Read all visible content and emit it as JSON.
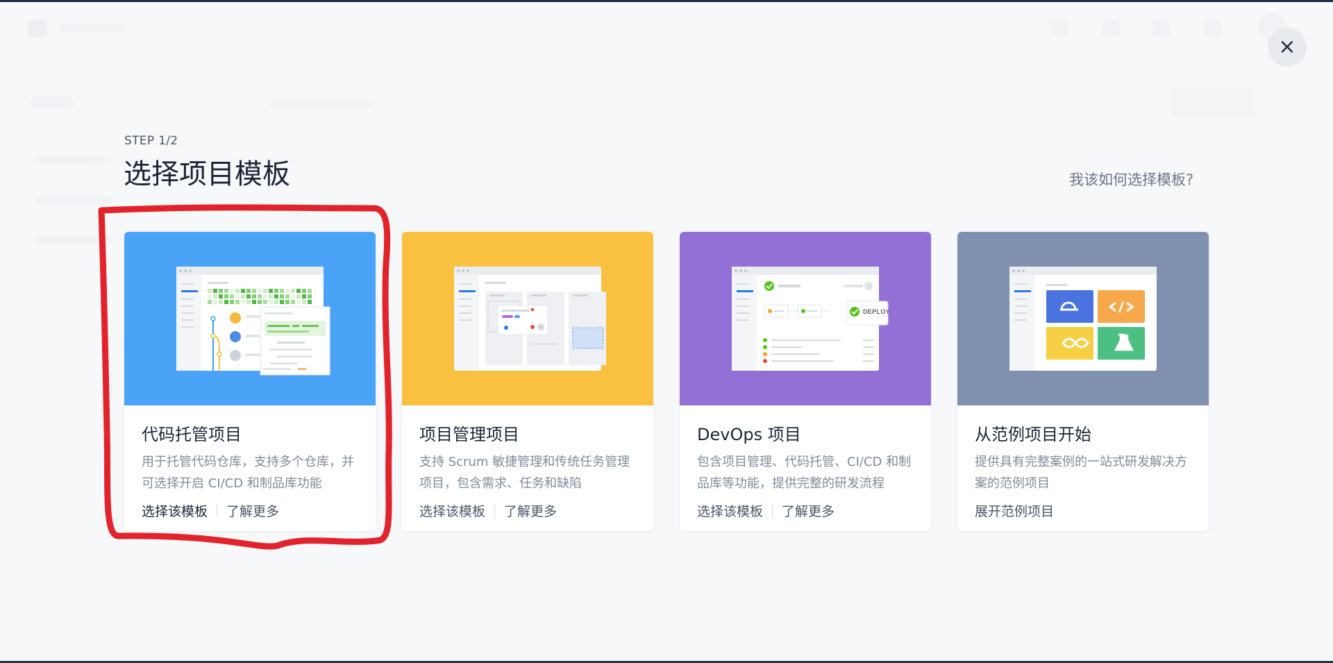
{
  "step": "STEP 1/2",
  "title": "选择项目模板",
  "help_link": "我该如何选择模板?",
  "close_symbol": "×",
  "colors": {
    "card1": "#4aa3f7",
    "card2": "#f9c13f",
    "card3": "#9270d6",
    "card4": "#8091b0",
    "highlight": "#e3232b"
  },
  "cards": [
    {
      "title": "代码托管项目",
      "desc": "用于托管代码仓库，支持多个仓库，并可选择开启 CI/CD 和制品库功能",
      "action_primary": "选择该模板",
      "action_secondary": "了解更多"
    },
    {
      "title": "项目管理项目",
      "desc": "支持 Scrum 敏捷管理和传统任务管理项目，包含需求、任务和缺陷",
      "action_primary": "选择该模板",
      "action_secondary": "了解更多"
    },
    {
      "title": "DevOps 项目",
      "desc": "包含项目管理、代码托管、CI/CD 和制品库等功能，提供完整的研发流程",
      "action_primary": "选择该模板",
      "action_secondary": "了解更多",
      "illustration_badge": "DEPLOY"
    },
    {
      "title": "从范例项目开始",
      "desc": "提供具有完整案例的一站式研发解决方案的范例项目",
      "action_primary": "展开范例项目"
    }
  ],
  "icons": [
    "close-icon",
    "cloud-icon",
    "code-icon",
    "infinity-icon",
    "flask-icon",
    "check-icon"
  ]
}
